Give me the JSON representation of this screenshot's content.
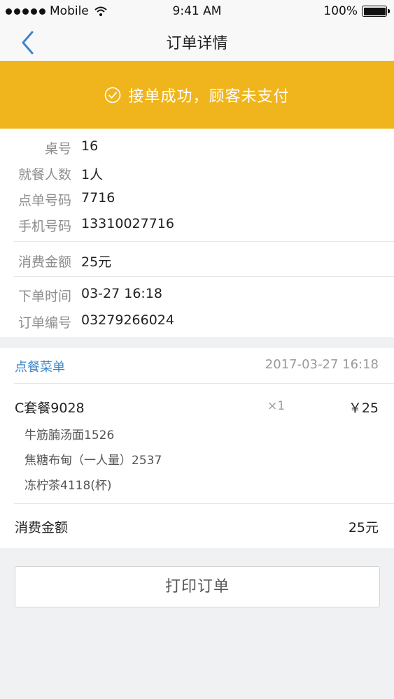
{
  "status_bar": {
    "carrier": "Mobile",
    "time": "9:41 AM",
    "battery": "100%"
  },
  "nav": {
    "title": "订单详情"
  },
  "banner": {
    "text": "接单成功，顾客未支付",
    "color": "#f0b51c"
  },
  "order_info": {
    "rows": [
      {
        "label": "桌号",
        "value": "16"
      },
      {
        "label": "就餐人数",
        "value": "1人"
      },
      {
        "label": "点单号码",
        "value": "7716"
      },
      {
        "label": "手机号码",
        "value": "13310027716"
      },
      {
        "label": "消费金额",
        "value": "25元"
      },
      {
        "label": "下单时间",
        "value": "03-27 16:18"
      },
      {
        "label": "订单编号",
        "value": "03279266024"
      }
    ]
  },
  "menu": {
    "title": "点餐菜单",
    "time": "2017-03-27 16:18",
    "item": {
      "name": "C套餐9028",
      "qty": "×1",
      "price": "￥25",
      "sub_items": [
        "牛筋腩汤面1526",
        "焦糖布甸（一人量）2537",
        "冻柠茶4118(杯)"
      ]
    },
    "total_label": "消费金额",
    "total_value": "25元"
  },
  "actions": {
    "print_label": "打印订单"
  },
  "colors": {
    "accent_blue": "#3a87c9",
    "background": "#eff1f3"
  }
}
